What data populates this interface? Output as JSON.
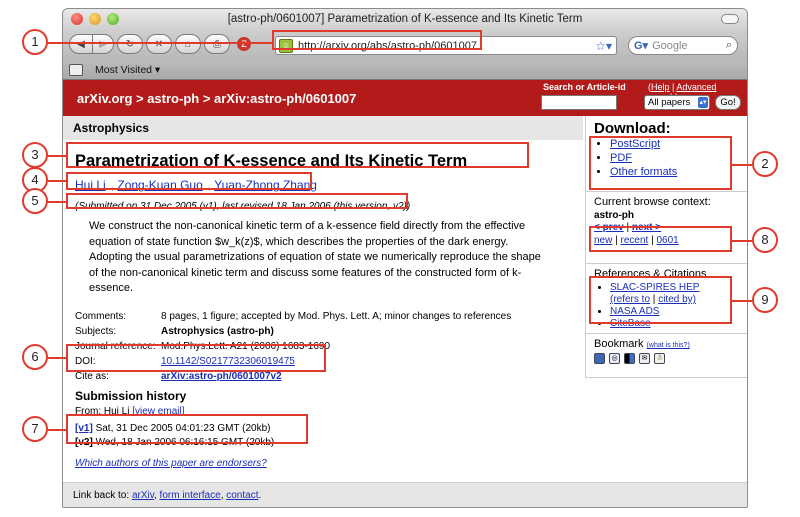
{
  "window": {
    "title": "[astro-ph/0601007] Parametrization of K-essence and Its Kinetic Term"
  },
  "browser": {
    "url": "http://arxiv.org/abs/astro-ph/0601007",
    "search_placeholder": "Google",
    "bookmarks_label": "Most Visited ▾"
  },
  "header": {
    "breadcrumb": "arXiv.org > astro-ph > arXiv:astro-ph/0601007",
    "search_label": "Search or Article-id",
    "help_label": "Help",
    "advanced_label": "Advanced search",
    "select_value": "All papers",
    "go_label": "Go!"
  },
  "paper": {
    "subject_bar": "Astrophysics",
    "title": "Parametrization of K-essence and Its Kinetic Term",
    "authors": [
      "Hui Li",
      "Zong-Kuan Guo",
      "Yuan-Zhong Zhang"
    ],
    "dateline": "(Submitted on 31 Dec 2005 (v1), last revised 18 Jan 2006 (this version, v2))",
    "abstract": "We construct the non-canonical kinetic term of a k-essence field directly from the effective equation of state function $w_k(z)$, which describes the properties of the dark energy. Adopting the usual parametrizations of equation of state we numerically reproduce the shape of the non-canonical kinetic term and discuss some features of the constructed form of k-essence.",
    "meta": {
      "comments_k": "Comments:",
      "comments_v": "8 pages, 1 figure; accepted by Mod. Phys. Lett. A; minor changes to references",
      "subjects_k": "Subjects:",
      "subjects_v": "Astrophysics (astro-ph)",
      "journal_k": "Journal reference:",
      "journal_v": "Mod.Phys.Lett. A21 (2006) 1683-1690",
      "doi_k": "DOI:",
      "doi_v": "10.1142/S0217732306019475",
      "cite_k": "Cite as:",
      "cite_v": "arXiv:astro-ph/0601007v2"
    },
    "history": {
      "heading": "Submission history",
      "from": "From: Hui Li",
      "from_link": "[view email]",
      "v1_tag": "[v1]",
      "v1_text": "Sat, 31 Dec 2005 04:01:23 GMT (20kb)",
      "v2_tag": "[v2]",
      "v2_text": "Wed, 18 Jan 2006 06:16:15 GMT (20kb)"
    },
    "endorsers": "Which authors of this paper are endorsers?"
  },
  "sidebar": {
    "download_heading": "Download:",
    "downloads": [
      "PostScript",
      "PDF",
      "Other formats"
    ],
    "browse_heading": "Current browse context:",
    "browse_cat": "astro-ph",
    "prev": "< prev",
    "sep": "|",
    "next": "next >",
    "new": "new",
    "recent": "recent",
    "month": "0601",
    "refs_heading": "References & Citations",
    "slac": "SLAC-SPIRES HEP",
    "refers_to": "(refers to",
    "cited_by": "cited by)",
    "nasa": "NASA ADS",
    "citebase": "CiteBase",
    "bookmark_heading": "Bookmark",
    "bookmark_what": "(what is this?)"
  },
  "footer": {
    "prefix": "Link back to:",
    "links": [
      "arXiv",
      "form interface",
      "contact"
    ]
  },
  "callouts": [
    "1",
    "2",
    "3",
    "4",
    "5",
    "6",
    "7",
    "8",
    "9"
  ],
  "colors": {
    "arxiv_red": "#b31b1b",
    "callout": "#e03b2f",
    "link": "#1a2fb8"
  }
}
